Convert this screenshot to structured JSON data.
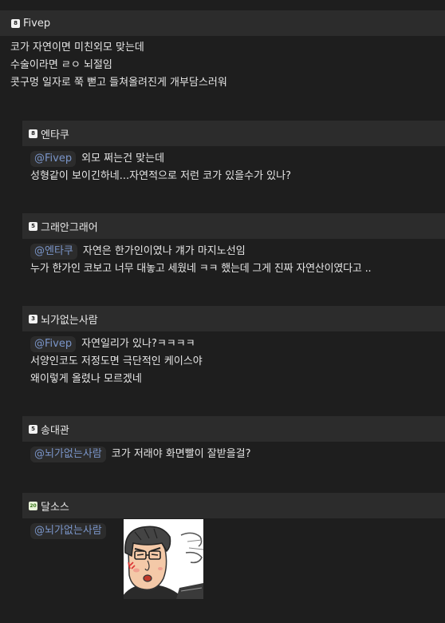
{
  "comments": [
    {
      "nick": "Fivep",
      "level": "8",
      "lines": [
        "코가 자연이면 미친외모 맞는데",
        "수술이라면 ㄹㅇ 뇌절임",
        "콧구멍 일자로 쭉 뻗고 들쳐올려진게 개부담스러워"
      ]
    },
    {
      "nick": "엔타쿠",
      "level": "8",
      "mention": "@Fivep",
      "first_text": "외모 쩌는건 맞는데",
      "lines": [
        "성형같이 보이긴하네...자연적으로 저런 코가 있을수가 있나?"
      ]
    },
    {
      "nick": "그래안그래어",
      "level": "5",
      "mention": "@엔타쿠",
      "first_text": "자연은 한가인이였나 걔가 마지노선임",
      "lines": [
        "누가 한가인 코보고 너무 대놓고 세웠네 ㅋㅋ 했는데 그게 진짜 자연산이였다고 .."
      ]
    },
    {
      "nick": "뇌가없는사람",
      "level": "3",
      "mention": "@Fivep",
      "first_text": "자연일리가 있나?ㅋㅋㅋㅋ",
      "lines": [
        "서양인코도 저정도면 극단적인 케이스야",
        "왜이렇게 올렸나 모르겠네"
      ]
    },
    {
      "nick": "송대관",
      "level": "5",
      "mention": "@뇌가없는사람",
      "first_text": "코가 저래야 화면빨이 잘받을걸?"
    },
    {
      "nick": "달소스",
      "level": "20",
      "mention": "@뇌가없는사람"
    }
  ],
  "icons": {
    "level_badge": "level-badge-icon",
    "sticker": "angry-man-sticker"
  },
  "colors": {
    "background": "#1e1e1e",
    "header": "#2c2c2c",
    "mention": "#7a95c9"
  }
}
